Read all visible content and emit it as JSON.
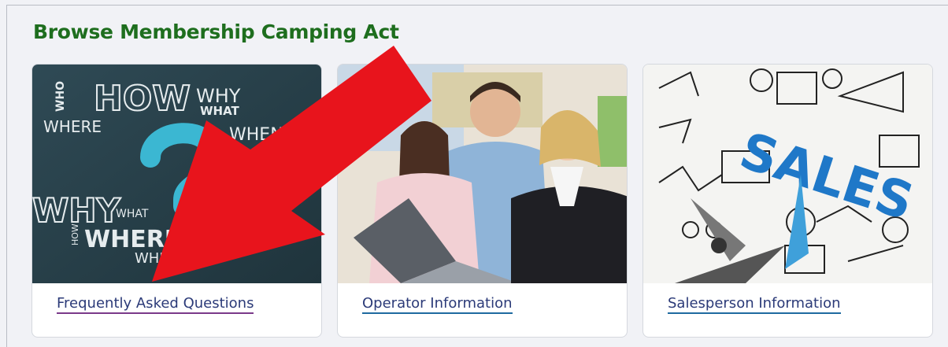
{
  "section": {
    "title": "Browse Membership Camping Act"
  },
  "cards": [
    {
      "link_label": "Frequently Asked Questions",
      "image_icon": "question-words-image",
      "image_words": [
        "WHO",
        "HOW",
        "WHY",
        "WHAT",
        "WHERE",
        "WHEN",
        "WHY",
        "WHAT",
        "HOW",
        "WHERE",
        "WHEN"
      ]
    },
    {
      "link_label": "Operator Information",
      "image_icon": "office-meeting-image"
    },
    {
      "link_label": "Salesperson Information",
      "image_icon": "sales-compass-image",
      "image_words": [
        "SALES"
      ]
    }
  ],
  "colors": {
    "title_green": "#1e6e1e",
    "link_blue": "#2b3a78",
    "arrow_red": "#e8141c"
  }
}
